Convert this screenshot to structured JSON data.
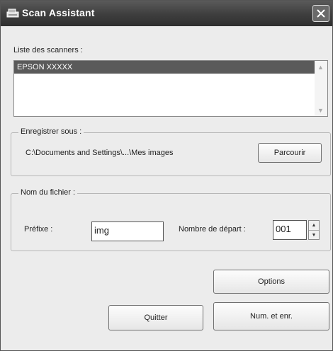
{
  "window": {
    "title": "Scan Assistant"
  },
  "scanners": {
    "label": "Liste des scanners :",
    "items": [
      "EPSON XXXXX"
    ]
  },
  "save": {
    "group_label": "Enregistrer sous :",
    "path": "C:\\Documents and Settings\\...\\Mes images",
    "browse_label": "Parcourir"
  },
  "filename": {
    "group_label": "Nom du fichier :",
    "prefix_label": "Préfixe :",
    "prefix_value": "img",
    "start_label": "Nombre de départ :",
    "start_value": "001"
  },
  "buttons": {
    "options": "Options",
    "quit": "Quitter",
    "scan_save": "Num. et enr."
  }
}
